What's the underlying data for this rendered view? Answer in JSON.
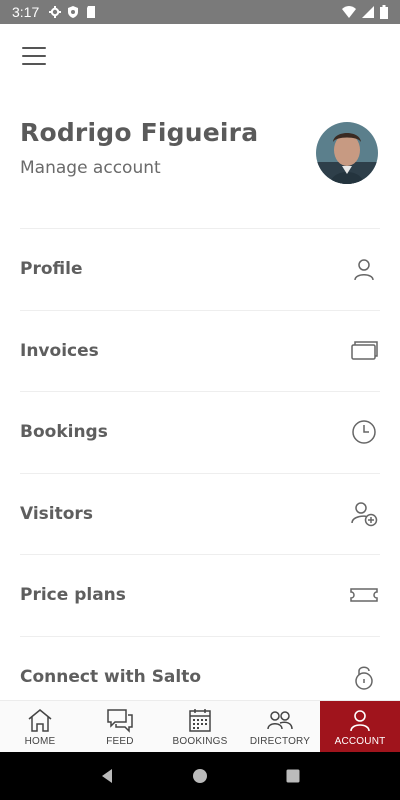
{
  "status_bar": {
    "time": "3:17",
    "left_icons": [
      "gear-icon",
      "shield-icon",
      "sd-card-icon"
    ],
    "right_icons": [
      "wifi-icon",
      "cellular-icon",
      "battery-icon"
    ],
    "background": "#7a7a7a"
  },
  "header": {
    "menu_icon": "hamburger-menu-icon"
  },
  "profile": {
    "name": "Rodrigo Figueira",
    "manage_label": "Manage account"
  },
  "menu": {
    "items": [
      {
        "label": "Profile",
        "icon": "user-icon"
      },
      {
        "label": "Invoices",
        "icon": "wallet-icon"
      },
      {
        "label": "Bookings",
        "icon": "clock-icon"
      },
      {
        "label": "Visitors",
        "icon": "add-user-icon"
      },
      {
        "label": "Price plans",
        "icon": "ticket-icon"
      },
      {
        "label": "Connect with Salto",
        "icon": "unlock-icon"
      }
    ]
  },
  "bottom_nav": {
    "active_color": "#a0141c",
    "tabs": [
      {
        "label": "HOME",
        "icon": "home-icon",
        "active": false
      },
      {
        "label": "FEED",
        "icon": "chat-icon",
        "active": false
      },
      {
        "label": "BOOKINGS",
        "icon": "calendar-icon",
        "active": false
      },
      {
        "label": "DIRECTORY",
        "icon": "people-icon",
        "active": false
      },
      {
        "label": "ACCOUNT",
        "icon": "user-icon",
        "active": true
      }
    ]
  },
  "system_nav": {
    "buttons": [
      "back-icon",
      "home-circle-icon",
      "recents-icon"
    ]
  }
}
